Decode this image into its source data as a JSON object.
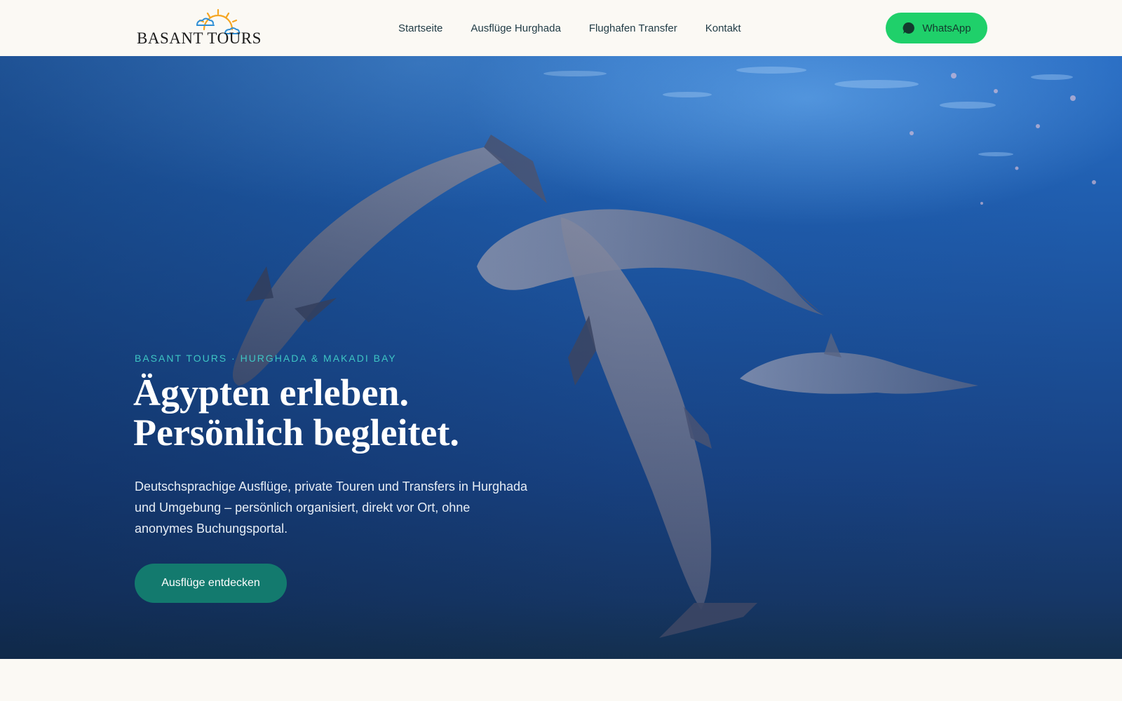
{
  "header": {
    "logo_text": "BASANT TOURS",
    "nav": [
      {
        "label": "Startseite"
      },
      {
        "label": "Ausflüge Hurghada"
      },
      {
        "label": "Flughafen Transfer"
      },
      {
        "label": "Kontakt"
      }
    ],
    "whatsapp_label": "WhatsApp",
    "whatsapp_icon": "chat-bubble-icon"
  },
  "hero": {
    "eyebrow": "BASANT TOURS · HURGHADA & MAKADI BAY",
    "headline_line1": "Ägypten erleben.",
    "headline_line2": "Persönlich begleitet.",
    "description": "Deutschsprachige Ausflüge, private Touren und Transfers in Hurghada und Umgebung – persönlich organisiert, direkt vor Ort, ohne anonymes Buchungsportal.",
    "cta_label": "Ausflüge entdecken"
  },
  "colors": {
    "background": "#fbf9f4",
    "nav_text": "#1f3a44",
    "whatsapp_green": "#1fd06a",
    "eyebrow_teal": "#3ec6c4",
    "cta_teal": "#137a6e",
    "logo_sun": "#f5a623",
    "logo_cloud": "#2f8fd6"
  }
}
